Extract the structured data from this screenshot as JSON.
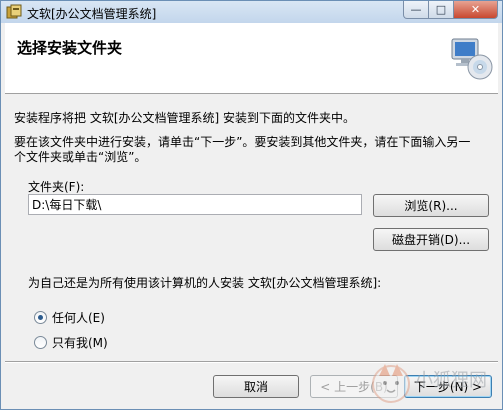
{
  "window": {
    "title": "文软[办公文档管理系统]",
    "controls": {
      "minimize": "—",
      "maximize": "□",
      "close": "✕"
    }
  },
  "header": {
    "title": "选择安装文件夹"
  },
  "body": {
    "intro": "安装程序将把 文软[办公文档管理系统] 安装到下面的文件夹中。",
    "instruction_line1": "要在该文件夹中进行安装，请单击“下一步”。要安装到其他文件夹，请在下面输入另一",
    "instruction_line2": "个文件夹或单击“浏览”。"
  },
  "folder": {
    "label": "文件夹(F):",
    "value": "D:\\每日下载\\",
    "browse_label": "浏览(R)...",
    "disk_cost_label": "磁盘开销(D)..."
  },
  "install_for": {
    "question": "为自己还是为所有使用该计算机的人安装 文软[办公文档管理系统]:",
    "options": [
      {
        "label": "任何人(E)",
        "selected": true
      },
      {
        "label": "只有我(M)",
        "selected": false
      }
    ]
  },
  "footer": {
    "cancel_label": "取消",
    "back_label": "< 上一步(B)",
    "next_label": "下一步(N) >"
  },
  "watermark": {
    "text": "小狐狸网"
  },
  "colors": {
    "accent": "#3c7fb1",
    "title_bar": "#c3d6ec"
  }
}
